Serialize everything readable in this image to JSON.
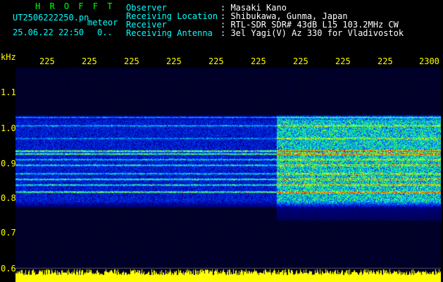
{
  "header": {
    "brand": "H R O F F T",
    "filename": "UT2506222250.pn",
    "category": "meteor",
    "datetime": "25.06.22 22:50",
    "counter": "0.."
  },
  "info": {
    "rows": [
      {
        "label": "Observer",
        "value": ": Masaki Kano"
      },
      {
        "label": "Receiving Location",
        "value": ": Shibukawa, Gunma, Japan"
      },
      {
        "label": "Receiver",
        "value": ": RTL-SDR SDR# 43dB L15 103.2MHz CW"
      },
      {
        "label": "Receiving Antenna",
        "value": ": 3el Yagi(V) Az 330 for Vladivostok"
      }
    ]
  },
  "axes": {
    "freq_unit": "kHz",
    "freq_ticks": [
      "1.1",
      "1.0",
      "0.9",
      "0.8",
      "0.7",
      "0.6"
    ],
    "time_ticks": [
      "225",
      "225",
      "225",
      "225",
      "225",
      "225",
      "225",
      "225",
      "225",
      "2300"
    ]
  },
  "colors": {
    "brand": "#00ff00",
    "labels": "#00ffff",
    "ticks": "#ffff00",
    "background": "#000000"
  }
}
